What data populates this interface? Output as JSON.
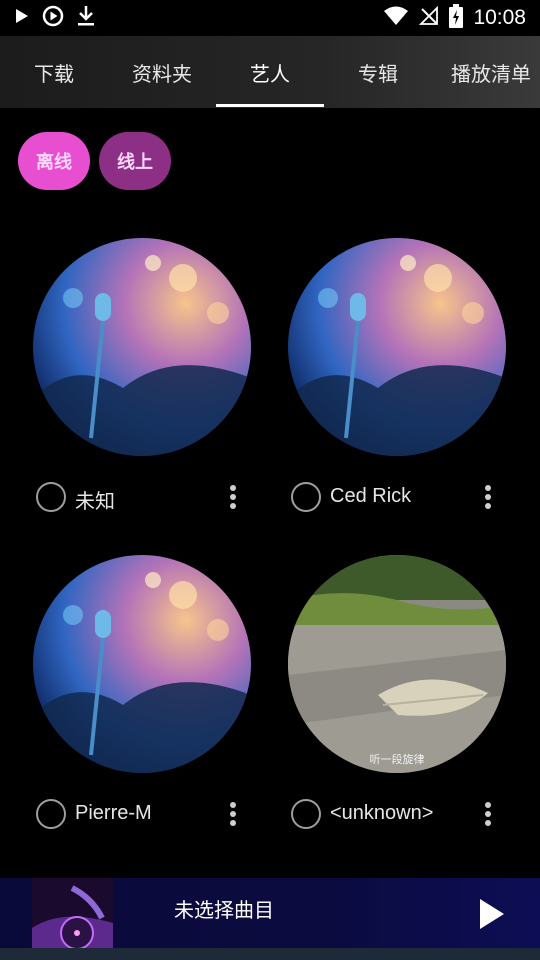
{
  "status": {
    "time": "10:08"
  },
  "tabs": [
    "下载",
    "资料夹",
    "艺人",
    "专辑",
    "播放清单"
  ],
  "chips": {
    "offline": "离线",
    "online": "线上"
  },
  "artists": [
    {
      "name": "未知"
    },
    {
      "name": "Ced Rick"
    },
    {
      "name": "Pierre-M"
    },
    {
      "name": "<unknown>"
    }
  ],
  "leaf_caption": "听一段旋律",
  "player": {
    "title": "未选择曲目"
  },
  "colors": {
    "chip_offline": "#e74fd0",
    "chip_online": "#8e2f86",
    "player_bg": "#0b0b40"
  }
}
